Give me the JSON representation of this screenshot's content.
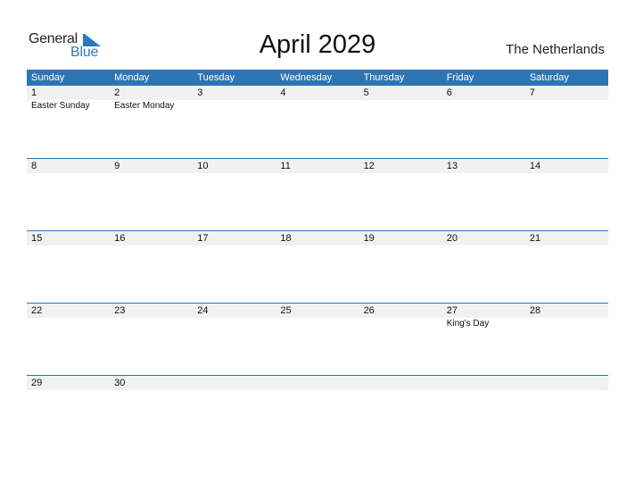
{
  "logo": {
    "text1": "General",
    "text2": "Blue",
    "brand_color": "#2a7ac0"
  },
  "title": "April 2029",
  "country": "The Netherlands",
  "header_color": "#2e74b5",
  "weekdays": [
    "Sunday",
    "Monday",
    "Tuesday",
    "Wednesday",
    "Thursday",
    "Friday",
    "Saturday"
  ],
  "weeks": [
    {
      "days": [
        {
          "d": "1",
          "h": "Easter Sunday"
        },
        {
          "d": "2",
          "h": "Easter Monday"
        },
        {
          "d": "3",
          "h": ""
        },
        {
          "d": "4",
          "h": ""
        },
        {
          "d": "5",
          "h": ""
        },
        {
          "d": "6",
          "h": ""
        },
        {
          "d": "7",
          "h": ""
        }
      ]
    },
    {
      "days": [
        {
          "d": "8",
          "h": ""
        },
        {
          "d": "9",
          "h": ""
        },
        {
          "d": "10",
          "h": ""
        },
        {
          "d": "11",
          "h": ""
        },
        {
          "d": "12",
          "h": ""
        },
        {
          "d": "13",
          "h": ""
        },
        {
          "d": "14",
          "h": ""
        }
      ]
    },
    {
      "days": [
        {
          "d": "15",
          "h": ""
        },
        {
          "d": "16",
          "h": ""
        },
        {
          "d": "17",
          "h": ""
        },
        {
          "d": "18",
          "h": ""
        },
        {
          "d": "19",
          "h": ""
        },
        {
          "d": "20",
          "h": ""
        },
        {
          "d": "21",
          "h": ""
        }
      ]
    },
    {
      "days": [
        {
          "d": "22",
          "h": ""
        },
        {
          "d": "23",
          "h": ""
        },
        {
          "d": "24",
          "h": ""
        },
        {
          "d": "25",
          "h": ""
        },
        {
          "d": "26",
          "h": ""
        },
        {
          "d": "27",
          "h": "King's Day"
        },
        {
          "d": "28",
          "h": ""
        }
      ]
    },
    {
      "days": [
        {
          "d": "29",
          "h": ""
        },
        {
          "d": "30",
          "h": ""
        },
        {
          "d": "",
          "h": ""
        },
        {
          "d": "",
          "h": ""
        },
        {
          "d": "",
          "h": ""
        },
        {
          "d": "",
          "h": ""
        },
        {
          "d": "",
          "h": ""
        }
      ]
    }
  ]
}
